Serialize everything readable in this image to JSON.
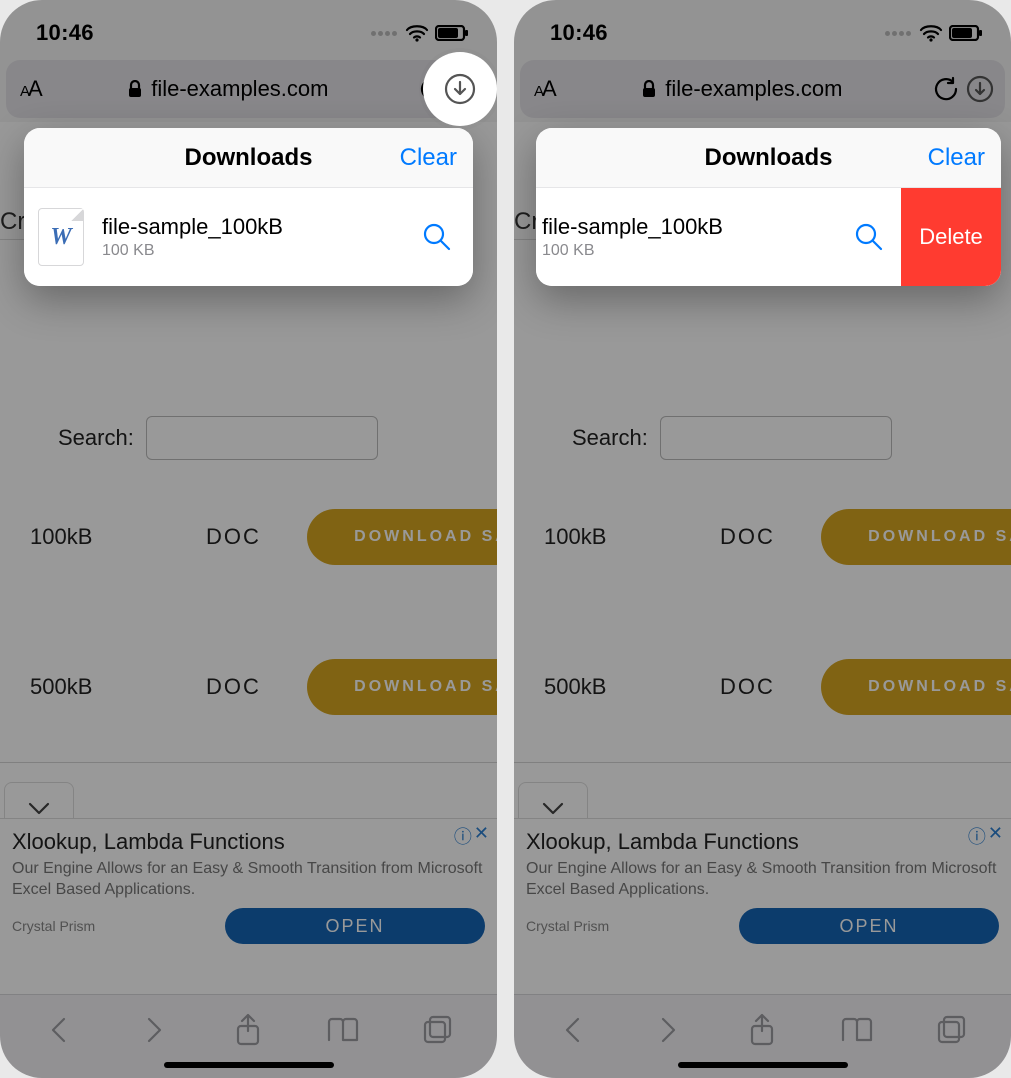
{
  "status": {
    "time": "10:46"
  },
  "urlbar": {
    "domain": "file-examples.com"
  },
  "page": {
    "cry_fragment": "Cry",
    "search_label": "Search:",
    "rows": [
      {
        "size": "100kB",
        "type": "DOC",
        "button": "DOWNLOAD SA"
      },
      {
        "size": "500kB",
        "type": "DOC",
        "button": "DOWNLOAD SA"
      }
    ]
  },
  "ad": {
    "title": "Xlookup, Lambda Functions",
    "desc": "Our Engine Allows for an Easy & Smooth Transition from Microsoft Excel Based Applications.",
    "brand": "Crystal Prism",
    "cta": "OPEN"
  },
  "downloads": {
    "title": "Downloads",
    "clear": "Clear",
    "item": {
      "name": "file-sample_100kB",
      "size": "100 KB",
      "doc_glyph": "W"
    },
    "delete": "Delete"
  }
}
